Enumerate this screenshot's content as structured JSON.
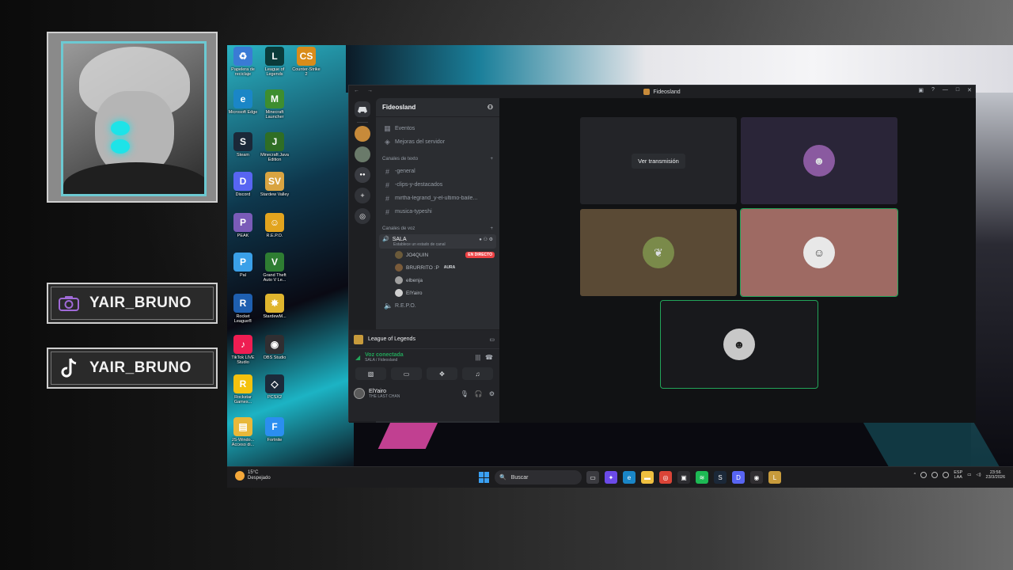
{
  "overlay": {
    "socials": [
      {
        "icon": "camera-icon",
        "name": "YAIR_BRUNO"
      },
      {
        "icon": "music-note-icon",
        "name": "YAIR_BRUNO"
      }
    ]
  },
  "desktop": {
    "icons": [
      {
        "label": "Papelera de reciclaje",
        "color": "#3a7bd5",
        "glyph": "♻"
      },
      {
        "label": "League of Legends",
        "color": "#0a3b3a",
        "glyph": "L"
      },
      {
        "label": "Counter-Strike 2",
        "color": "#d98c1a",
        "glyph": "CS"
      },
      {
        "label": "Microsoft Edge",
        "color": "#1a86c7",
        "glyph": "e"
      },
      {
        "label": "Minecraft Launcher",
        "color": "#3e8e2f",
        "glyph": "M"
      },
      {
        "label": "Steam",
        "color": "#1b2838",
        "glyph": "S"
      },
      {
        "label": "Minecraft Java Edition",
        "color": "#2f6e25",
        "glyph": "J"
      },
      {
        "label": "Discord",
        "color": "#5865f2",
        "glyph": "D"
      },
      {
        "label": "Stardew Valley",
        "color": "#d9a441",
        "glyph": "SV"
      },
      {
        "label": "PEAK",
        "color": "#7a5bb8",
        "glyph": "P"
      },
      {
        "label": "R.E.P.O.",
        "color": "#e2a41e",
        "glyph": "☺"
      },
      {
        "label": "Pal",
        "color": "#3aa0e8",
        "glyph": "P"
      },
      {
        "label": "Grand Theft Auto V Le...",
        "color": "#2e7d32",
        "glyph": "V"
      },
      {
        "label": "Rocket League®",
        "color": "#1e5fb0",
        "glyph": "R"
      },
      {
        "label": "StardewM...",
        "color": "#e0b52e",
        "glyph": "✸"
      },
      {
        "label": "TikTok LIVE Studio",
        "color": "#ee1d52",
        "glyph": "♪"
      },
      {
        "label": "OBS Studio",
        "color": "#302e31",
        "glyph": "◉"
      },
      {
        "label": "Rockstar Games...",
        "color": "#f4c20d",
        "glyph": "R"
      },
      {
        "label": "PCSX2",
        "color": "#1c2a3a",
        "glyph": "◇"
      },
      {
        "label": "JS-Windo... Acceso di...",
        "color": "#e8b83a",
        "glyph": "▤"
      },
      {
        "label": "Fortnite",
        "color": "#2b8ef0",
        "glyph": "F"
      }
    ],
    "taskbar": {
      "weather_temp": "15°C",
      "weather_desc": "Despejado",
      "search_placeholder": "Buscar",
      "apps": [
        {
          "name": "task-view",
          "color": "#3b3b40",
          "glyph": "▭"
        },
        {
          "name": "copilot",
          "color": "#6b4ae8",
          "glyph": "✦"
        },
        {
          "name": "edge",
          "color": "#1a86c7",
          "glyph": "e"
        },
        {
          "name": "file-explorer",
          "color": "#f0c040",
          "glyph": "▬"
        },
        {
          "name": "chrome",
          "color": "#db4437",
          "glyph": "◎"
        },
        {
          "name": "store",
          "color": "#2d2d31",
          "glyph": "▣"
        },
        {
          "name": "spotify",
          "color": "#1db954",
          "glyph": "≋"
        },
        {
          "name": "steam",
          "color": "#1b2838",
          "glyph": "S"
        },
        {
          "name": "discord",
          "color": "#5865f2",
          "glyph": "D"
        },
        {
          "name": "obs",
          "color": "#302e31",
          "glyph": "◉"
        },
        {
          "name": "league",
          "color": "#c89b3c",
          "glyph": "L"
        }
      ],
      "lang": "ESP",
      "lang_sub": "LAA",
      "time": "23:56",
      "date": "23/3/2026"
    }
  },
  "discord": {
    "window_title": "Fideosland",
    "server_name": "Fideosland",
    "top_items": [
      "Eventos",
      "Mejoras del servidor"
    ],
    "text_category": "Canales de texto",
    "text_channels": [
      "-general",
      "-clips-y-destacados",
      "mirtha-legrand_y-el-ultimo-baile...",
      "musica-typeshi"
    ],
    "voice_category": "Canales de voz",
    "voice_channel": "SALA",
    "voice_status": "Establece un estado de canal",
    "voice_users": [
      {
        "name": "JO4QUIN",
        "color": "#6b5a3a",
        "badge": "EN DIRECTO"
      },
      {
        "name": "BRURRITO :P",
        "color": "#7a5b3a",
        "badge": "AURA"
      },
      {
        "name": "elbenja",
        "color": "#a0a0a0",
        "badge": ""
      },
      {
        "name": "ElYairo",
        "color": "#d0d0d0",
        "badge": ""
      }
    ],
    "other_voice": "R.E.P.O.",
    "activity": "League of Legends",
    "voice_connected": "Voz conectada",
    "voice_location": "SALA / Fideosland",
    "user_name": "ElYairo",
    "user_status": "THE LAST CHAN",
    "watch_label": "Ver transmisión",
    "colors": {
      "accent": "#5865f2",
      "speaking": "#23a55a",
      "live": "#ed4245"
    }
  }
}
